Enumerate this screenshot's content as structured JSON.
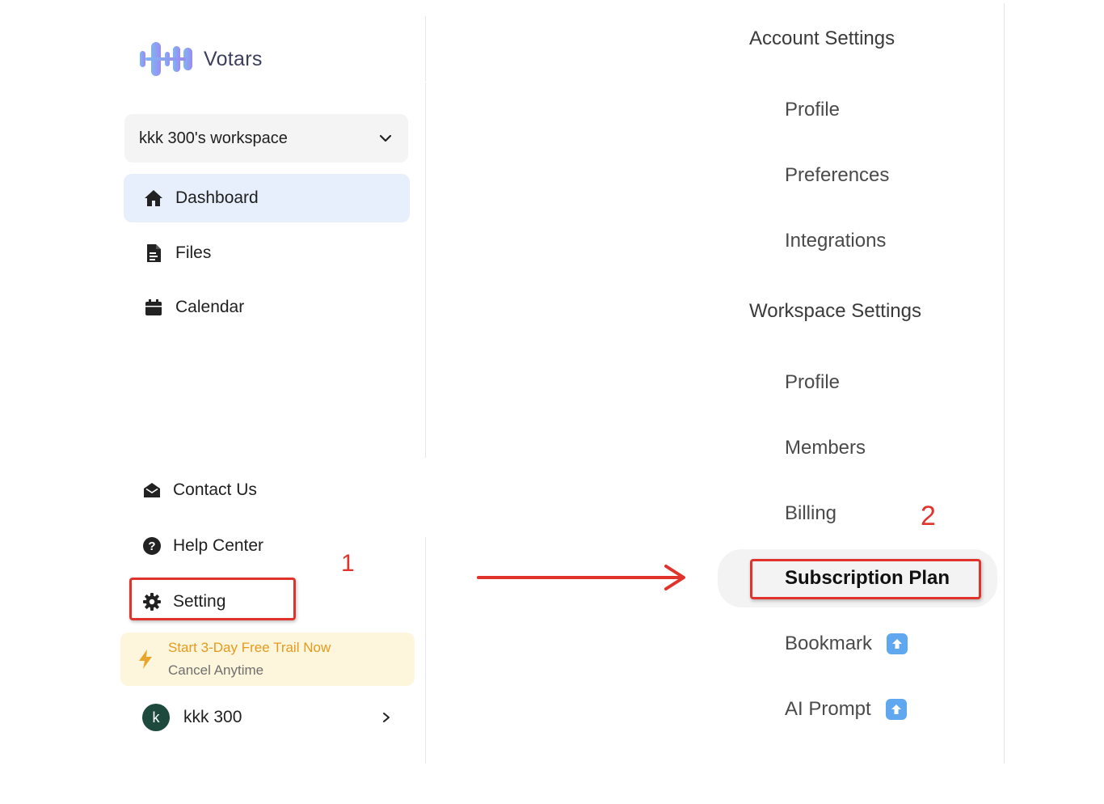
{
  "brand": {
    "name": "Votars"
  },
  "workspace": {
    "label": "kkk 300's workspace"
  },
  "nav": [
    {
      "label": "Dashboard",
      "icon": "home-icon",
      "active": true
    },
    {
      "label": "Files",
      "icon": "file-icon"
    },
    {
      "label": "Calendar",
      "icon": "calendar-icon"
    }
  ],
  "bottom_nav": [
    {
      "label": "Contact Us",
      "icon": "mail-open-icon"
    },
    {
      "label": "Help Center",
      "icon": "question-circle-icon"
    },
    {
      "label": "Setting",
      "icon": "gear-icon"
    }
  ],
  "trial": {
    "title": "Start 3-Day Free Trail Now",
    "subtitle": "Cancel Anytime",
    "icon": "lightning-icon"
  },
  "user": {
    "initial": "k",
    "name": "kkk 300"
  },
  "annotations": {
    "step1": "1",
    "step2": "2"
  },
  "settings": {
    "account_title": "Account Settings",
    "account_items": [
      "Profile",
      "Preferences",
      "Integrations"
    ],
    "workspace_title": "Workspace Settings",
    "workspace_items": [
      "Profile",
      "Members",
      "Billing",
      "Subscription Plan",
      "Bookmark",
      "AI Prompt"
    ]
  },
  "colors": {
    "annotation_red": "#e0332b",
    "active_bg": "#e7effd",
    "trial_bg": "#fdf6dc",
    "trial_text": "#e59a1d",
    "upgrade_badge": "#5fa8ef"
  }
}
